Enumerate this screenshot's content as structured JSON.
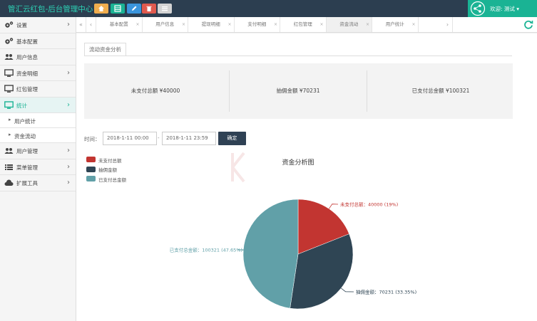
{
  "header": {
    "app_title": "管汇云红包-后台管理中心",
    "welcome_text": "欢迎: 测试 ▾",
    "toolbar_buttons": [
      {
        "icon": "home-icon",
        "color": "#f0ad4e"
      },
      {
        "icon": "grid-icon",
        "color": "#1ab394"
      },
      {
        "icon": "pencil-icon",
        "color": "#3a95dd"
      },
      {
        "icon": "trash-icon",
        "color": "#e05a4e"
      },
      {
        "icon": "list-icon",
        "color": "#d3d3d3"
      }
    ]
  },
  "sidebar": {
    "items": [
      {
        "label": "设置",
        "icon": "gears-icon",
        "arrow": "›"
      },
      {
        "label": "基本配置",
        "icon": "gears-icon",
        "arrow": ""
      },
      {
        "label": "用户信息",
        "icon": "users-icon",
        "arrow": ""
      },
      {
        "label": "资金明细",
        "icon": "monitor-icon",
        "arrow": "›"
      },
      {
        "label": "红包管理",
        "icon": "monitor-icon",
        "arrow": ""
      },
      {
        "label": "统计",
        "icon": "monitor-icon",
        "arrow": "›",
        "active": true
      },
      {
        "label": "用户统计",
        "sub": true
      },
      {
        "label": "资金流动",
        "sub": true
      },
      {
        "label": "用户管理",
        "icon": "users-icon",
        "arrow": "›"
      },
      {
        "label": "菜单管理",
        "icon": "list-icon",
        "arrow": "›"
      },
      {
        "label": "扩展工具",
        "icon": "cloud-icon",
        "arrow": "›"
      }
    ]
  },
  "tabs": {
    "back_glyph": "«",
    "prev_glyph": "‹",
    "next_glyph": "›",
    "close_glyph": "×",
    "items": [
      {
        "label": "基本配置"
      },
      {
        "label": "用户信息"
      },
      {
        "label": "提现明细"
      },
      {
        "label": "支付明细"
      },
      {
        "label": "红包管理"
      },
      {
        "label": "资金流动",
        "active": true
      },
      {
        "label": "用户统计"
      }
    ]
  },
  "main": {
    "section_tab": "流动资金分析",
    "stats": [
      {
        "text": "未支付总额 ¥40000"
      },
      {
        "text": "抽佣金额 ¥70231"
      },
      {
        "text": "已支付总金额 ¥100321"
      }
    ],
    "time_label": "时间：",
    "start_date": "2018-1-11 00:00",
    "date_separator": "-",
    "end_date": "2018-1-11 23:59",
    "confirm_label": "确定"
  },
  "chart_data": {
    "type": "pie",
    "title": "资金分析图",
    "slices": [
      {
        "name": "未支付总额",
        "value": 40000,
        "percent": 19,
        "color": "#c23531",
        "label": "未支付总额：40000 (19%)"
      },
      {
        "name": "抽佣金额",
        "value": 70231,
        "percent": 33.35,
        "color": "#2f4554",
        "label": "抽佣金额：70231 (33.35%)"
      },
      {
        "name": "已支付总金额",
        "value": 100321,
        "percent": 47.65,
        "color": "#61a0a8",
        "label": "已支付总金额：100321 (47.65%)"
      }
    ],
    "legend": [
      "未支付总额",
      "抽佣金额",
      "已支付总金额"
    ],
    "legend_position": "top-left"
  }
}
